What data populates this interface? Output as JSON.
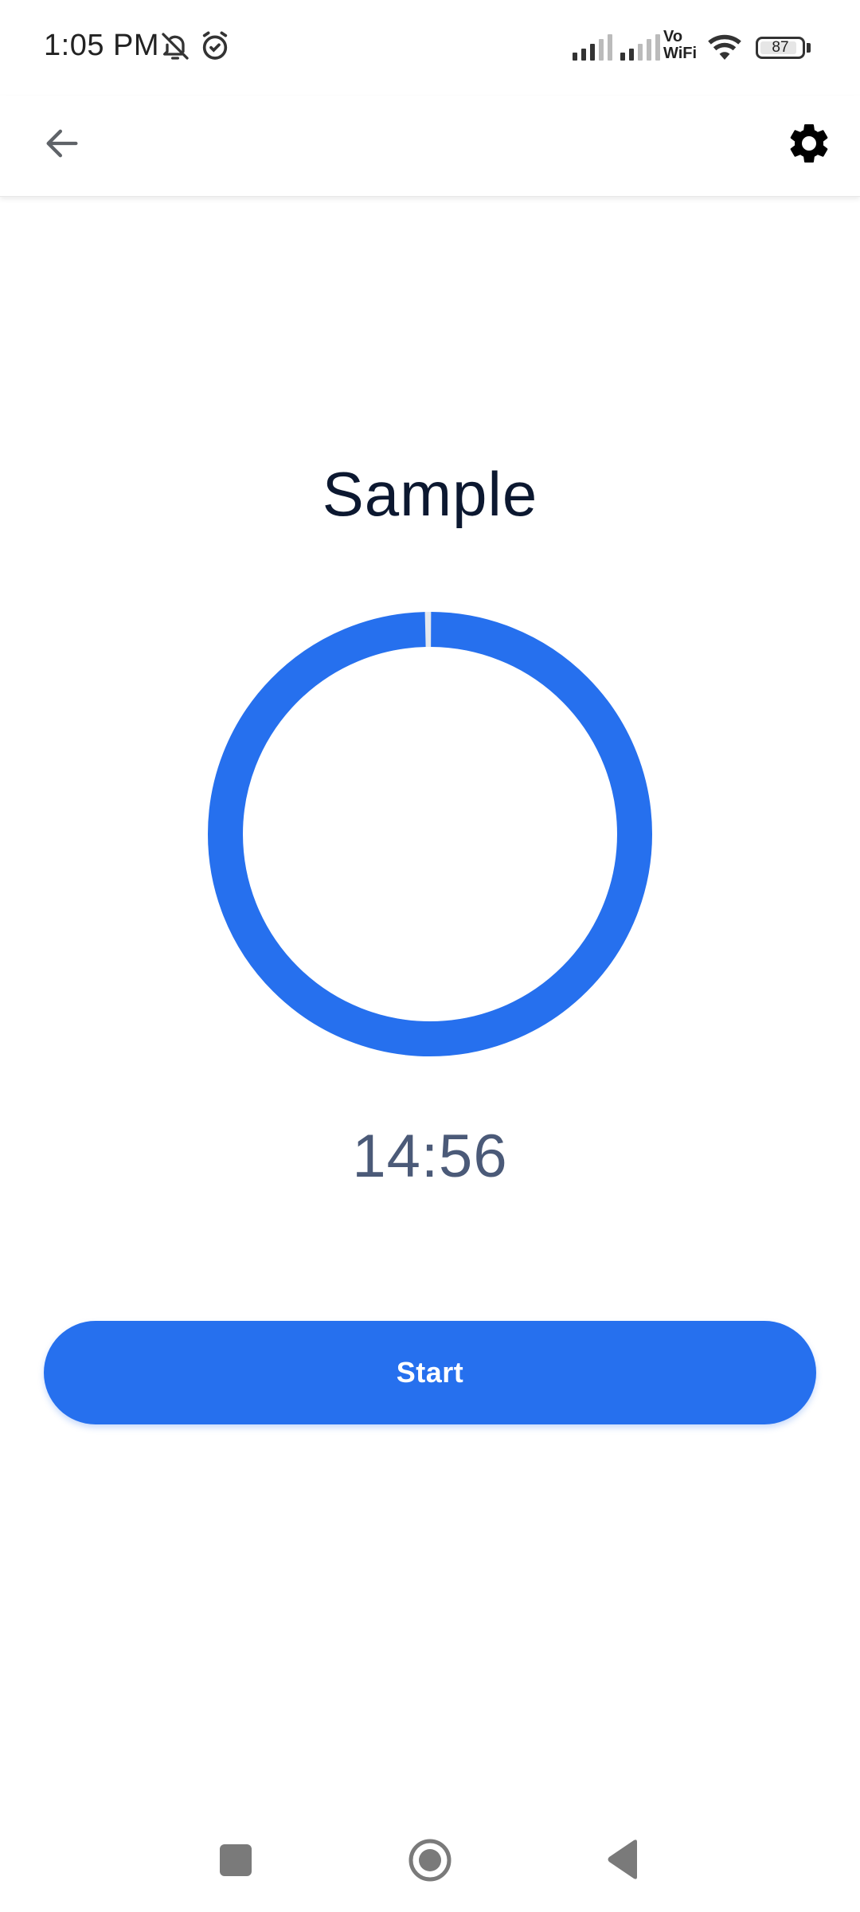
{
  "status_bar": {
    "time": "1:05 PM",
    "icons": [
      "bell-off-icon",
      "alarm-icon",
      "signal-icon",
      "signal-icon",
      "vowifi-icon",
      "wifi-icon",
      "battery-icon"
    ],
    "vowifi_line1": "Vo",
    "vowifi_line2": "WiFi",
    "battery_level": "87"
  },
  "app_bar": {
    "back_icon": "arrow-left-icon",
    "settings_icon": "gear-icon"
  },
  "main": {
    "title": "Sample",
    "progress_fraction": 0.997,
    "timer": "14:56",
    "start_label": "Start",
    "accent_color": "#2670ee",
    "timer_color": "#4b5a78"
  },
  "nav_bar": {
    "icons": [
      "recent-apps-icon",
      "home-icon",
      "back-icon"
    ]
  }
}
